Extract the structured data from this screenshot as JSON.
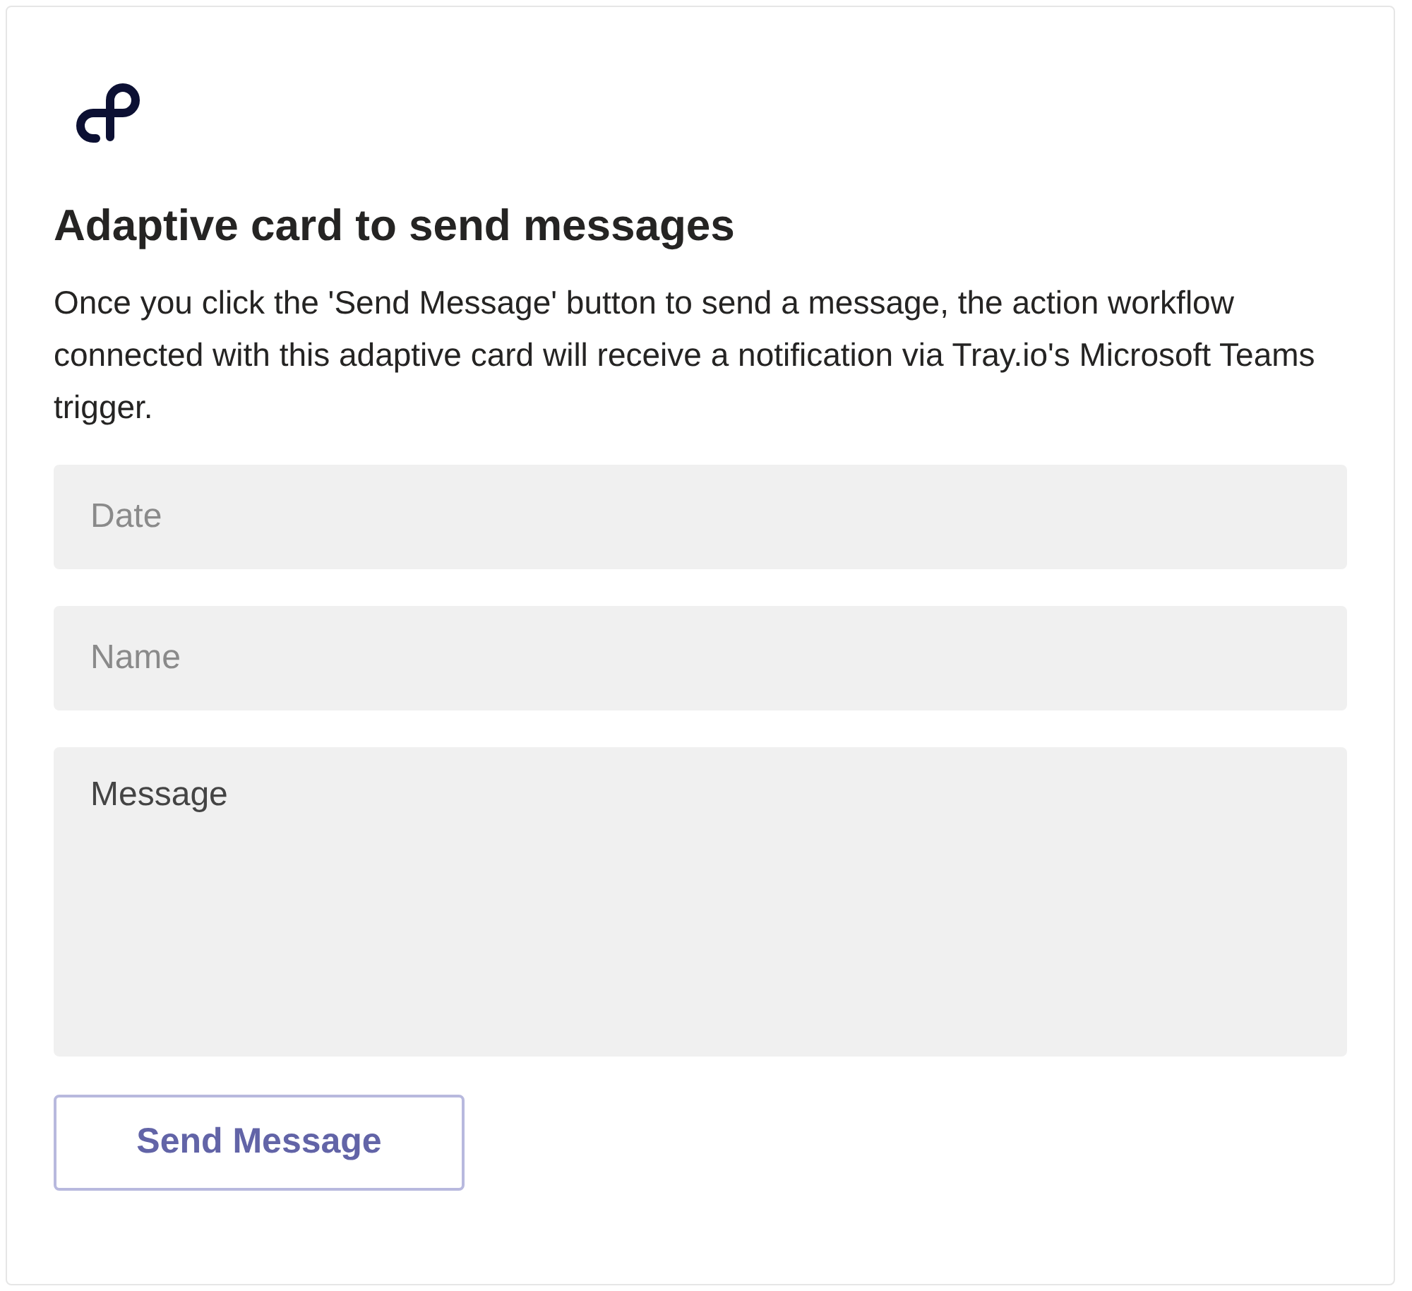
{
  "card": {
    "title": "Adaptive card to send messages",
    "description": "Once you click the 'Send Message' button to send a message, the action workflow connected with this adaptive card will receive a notification via Tray.io's Microsoft Teams trigger.",
    "fields": [
      {
        "kind": "input",
        "placeholder": "Date"
      },
      {
        "kind": "input",
        "placeholder": "Name"
      },
      {
        "kind": "textarea",
        "value": "Message"
      }
    ],
    "button": "Send Message"
  }
}
